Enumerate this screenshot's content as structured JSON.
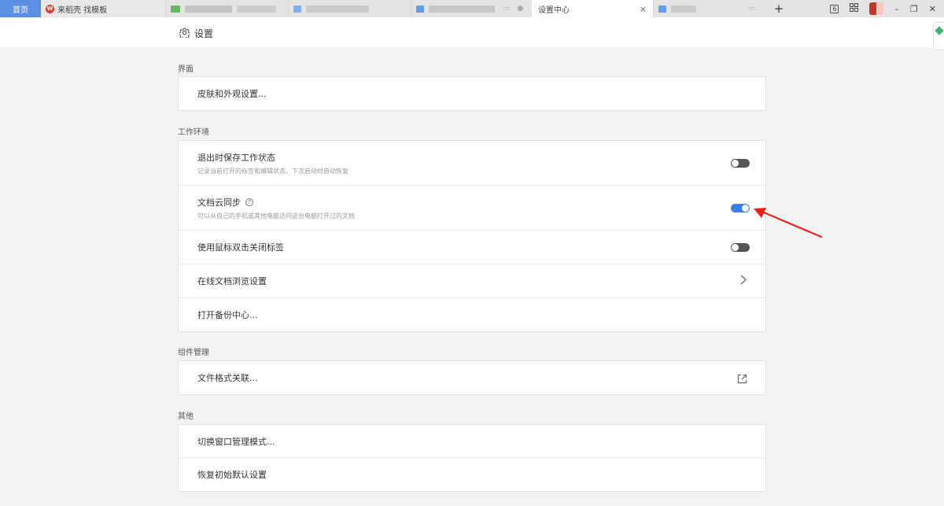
{
  "tabs": {
    "home": "首页",
    "daoke": "来稻壳 找模板",
    "daoke_logo": "W",
    "active": "设置中心",
    "close": "×",
    "add": "+"
  },
  "window": {
    "badge": "6",
    "minimize": "–",
    "restore": "❐",
    "close": "✕"
  },
  "header": {
    "title": "设置"
  },
  "sections": {
    "ui": {
      "label": "界面",
      "skin": "皮肤和外观设置..."
    },
    "workspace": {
      "label": "工作环境",
      "save_state": {
        "title": "退出时保存工作状态",
        "desc": "记录当前打开的标签和编辑状态，下次启动时自动恢复",
        "enabled": false
      },
      "cloud_sync": {
        "title": "文档云同步",
        "desc": "可以从自己的手机或其他电脑访问这台电脑打开过的文档",
        "enabled": true
      },
      "dblclick_close": {
        "title": "使用鼠标双击关闭标签",
        "enabled": false
      },
      "online_browse": "在线文档浏览设置",
      "backup": "打开备份中心..."
    },
    "components": {
      "label": "组件管理",
      "file_assoc": "文件格式关联..."
    },
    "other": {
      "label": "其他",
      "window_mode": "切换窗口管理模式...",
      "reset": "恢复初始默认设置"
    }
  },
  "colors": {
    "accent": "#3a7ee8",
    "home_tab": "#5b8fe6",
    "annotation_arrow": "#e8221b"
  }
}
